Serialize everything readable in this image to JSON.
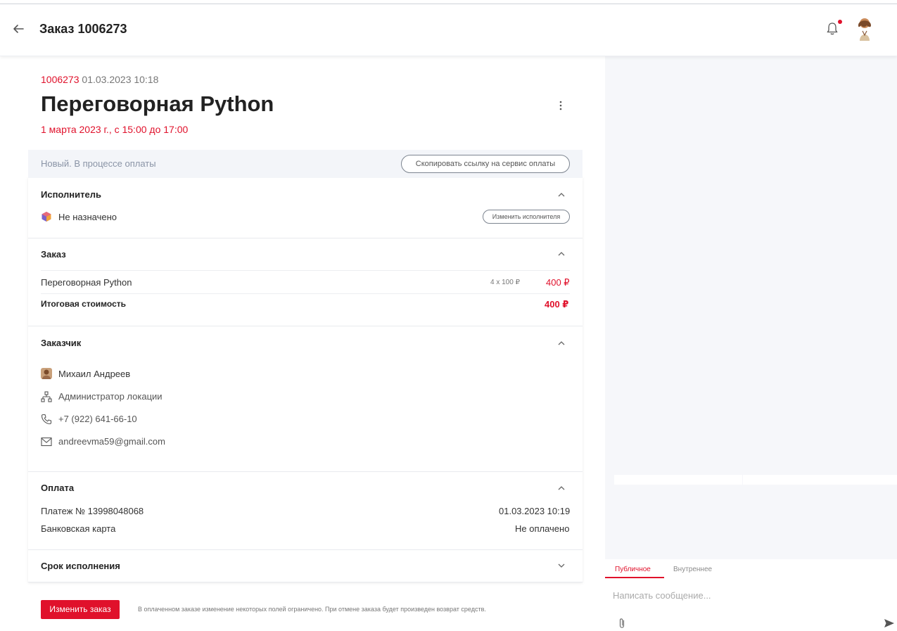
{
  "header": {
    "title": "Заказ 1006273"
  },
  "order": {
    "number": "1006273",
    "datetime": "01.03.2023 10:18",
    "title": "Переговорная Python",
    "schedule": "1 марта 2023 г., с 15:00 до 17:00"
  },
  "status": {
    "text": "Новый. В процессе оплаты",
    "copy_link_label": "Скопировать ссылку на сервис оплаты"
  },
  "executor": {
    "title": "Исполнитель",
    "value": "Не назначено",
    "change_label": "Изменить исполнителя"
  },
  "order_section": {
    "title": "Заказ",
    "item_name": "Переговорная Python",
    "item_calc": "4 x 100 ₽",
    "item_price": "400 ₽",
    "total_label": "Итоговая стоимость",
    "total_value": "400 ₽"
  },
  "customer": {
    "title": "Заказчик",
    "name": "Михаил Андреев",
    "role": "Администратор локации",
    "phone": "+7 (922) 641-66-10",
    "email": "andreevma59@gmail.com"
  },
  "payment": {
    "title": "Оплата",
    "payment_no": "Платеж № 13998048068",
    "payment_date": "01.03.2023 10:19",
    "method": "Банковская карта",
    "state": "Не оплачено"
  },
  "deadline": {
    "title": "Срок исполнения"
  },
  "footer": {
    "change_order_label": "Изменить заказ",
    "note": "В оплаченном заказе изменение некоторых полей ограничено. При отмене заказа будет произведен возврат средств."
  },
  "chat": {
    "tab_public": "Публичное",
    "tab_internal": "Внутреннее",
    "placeholder": "Написать сообщение..."
  },
  "colors": {
    "accent": "#e0112b",
    "muted": "#8a94a6",
    "panel_bg": "#f6f7fa"
  }
}
